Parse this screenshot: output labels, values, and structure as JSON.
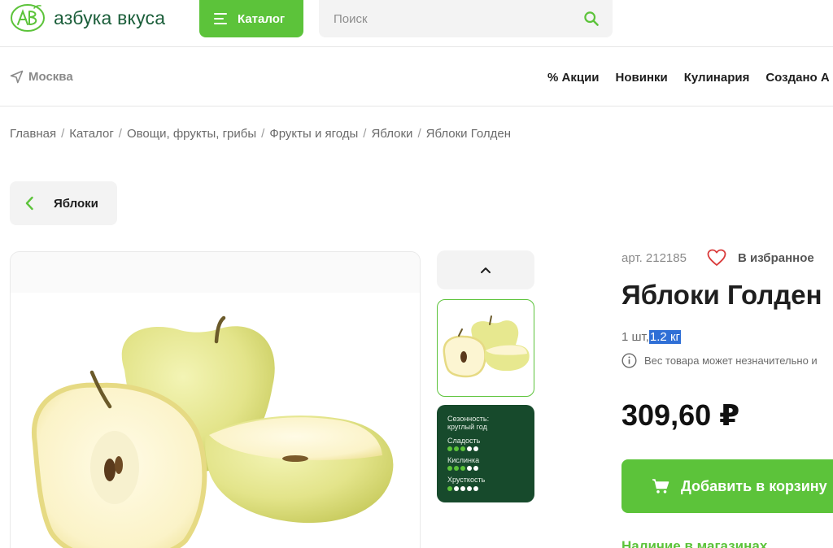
{
  "header": {
    "logo_text": "азбука вкуса",
    "catalog_label": "Каталог",
    "search_placeholder": "Поиск"
  },
  "subnav": {
    "city": "Москва",
    "menu": [
      "% Акции",
      "Новинки",
      "Кулинария",
      "Создано А"
    ]
  },
  "breadcrumb": [
    "Главная",
    "Каталог",
    "Овощи, фрукты, грибы",
    "Фрукты и ягоды",
    "Яблоки",
    "Яблоки Голден"
  ],
  "back_label": "Яблоки",
  "thumb_info": {
    "season_label": "Сезонность:",
    "season_value": "круглый год",
    "attributes": [
      {
        "label": "Сладость",
        "level": 3,
        "max": 5
      },
      {
        "label": "Кислинка",
        "level": 3,
        "max": 5
      },
      {
        "label": "Хрусткость",
        "level": 1,
        "max": 5
      }
    ]
  },
  "product": {
    "sku": "арт. 212185",
    "favorite_label": "В избранное",
    "title": "Яблоки Голден",
    "unit_prefix": "1 шт,",
    "unit_weight": "1.2 кг",
    "note": "Вес товара может незначительно и",
    "price": "309,60 ₽",
    "cart_label": "Добавить в корзину",
    "stores_label": "Наличие в магазинах"
  },
  "colors": {
    "accent": "#5cc33a",
    "brand_dark": "#1b5e3a",
    "info_card": "#174a2c"
  }
}
